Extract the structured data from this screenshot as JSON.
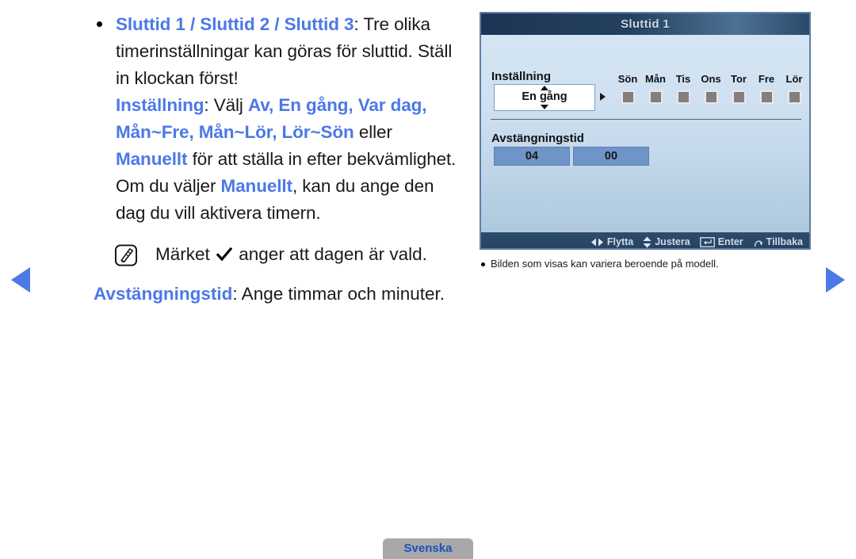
{
  "document": {
    "language_tab": "Svenska"
  },
  "nav": {
    "prev_label": "previous-page",
    "next_label": "next-page"
  },
  "content": {
    "bullet": {
      "heading_blue": "Sluttid 1 / Sluttid 2 / Sluttid 3",
      "heading_rest": ": Tre olika timerinställningar kan göras för sluttid. Ställ in klockan först!",
      "line2_label": "Inställning",
      "line2_mid": ": Välj ",
      "line2_options": "Av, En gång, Var dag, Mån~Fre, Mån~Lör, Lör~Sön",
      "line2_tail_a": " eller ",
      "line2_manuellt": "Manuellt",
      "line2_tail_b": " för att ställa in efter bekvämlighet. Om du väljer ",
      "line2_manuellt2": "Manuellt",
      "line2_tail_c": ", kan du ange den dag du vill aktivera timern."
    },
    "note": {
      "icon": "note-pen-icon",
      "text_before": "Märket ",
      "check_icon": "checkmark-icon",
      "text_after": " anger att dagen är vald."
    },
    "closing": {
      "label": "Avstängningstid",
      "rest": ": Ange timmar och minuter."
    }
  },
  "osd": {
    "title": "Sluttid 1",
    "setting_label": "Inställning",
    "setting_value": "En gång",
    "days": [
      {
        "name": "Sön",
        "checked": false
      },
      {
        "name": "Mån",
        "checked": false
      },
      {
        "name": "Tis",
        "checked": false
      },
      {
        "name": "Ons",
        "checked": false
      },
      {
        "name": "Tor",
        "checked": false
      },
      {
        "name": "Fre",
        "checked": false
      },
      {
        "name": "Lör",
        "checked": false
      }
    ],
    "offtime_label": "Avstängningstid",
    "offtime_hours": "04",
    "offtime_minutes": "00",
    "footer_hints": [
      {
        "icon": "left-right-arrows-icon",
        "label": "Flytta"
      },
      {
        "icon": "up-down-arrows-icon",
        "label": "Justera"
      },
      {
        "icon": "enter-key-icon",
        "label": "Enter"
      },
      {
        "icon": "return-arrow-icon",
        "label": "Tillbaka"
      }
    ],
    "caption": "Bilden som visas kan variera beroende på modell."
  },
  "colors": {
    "accent_blue": "#4c78e8",
    "osd_title_bg": "#24405f",
    "osd_value_box": "#6f95c8",
    "day_box": "#808080"
  }
}
